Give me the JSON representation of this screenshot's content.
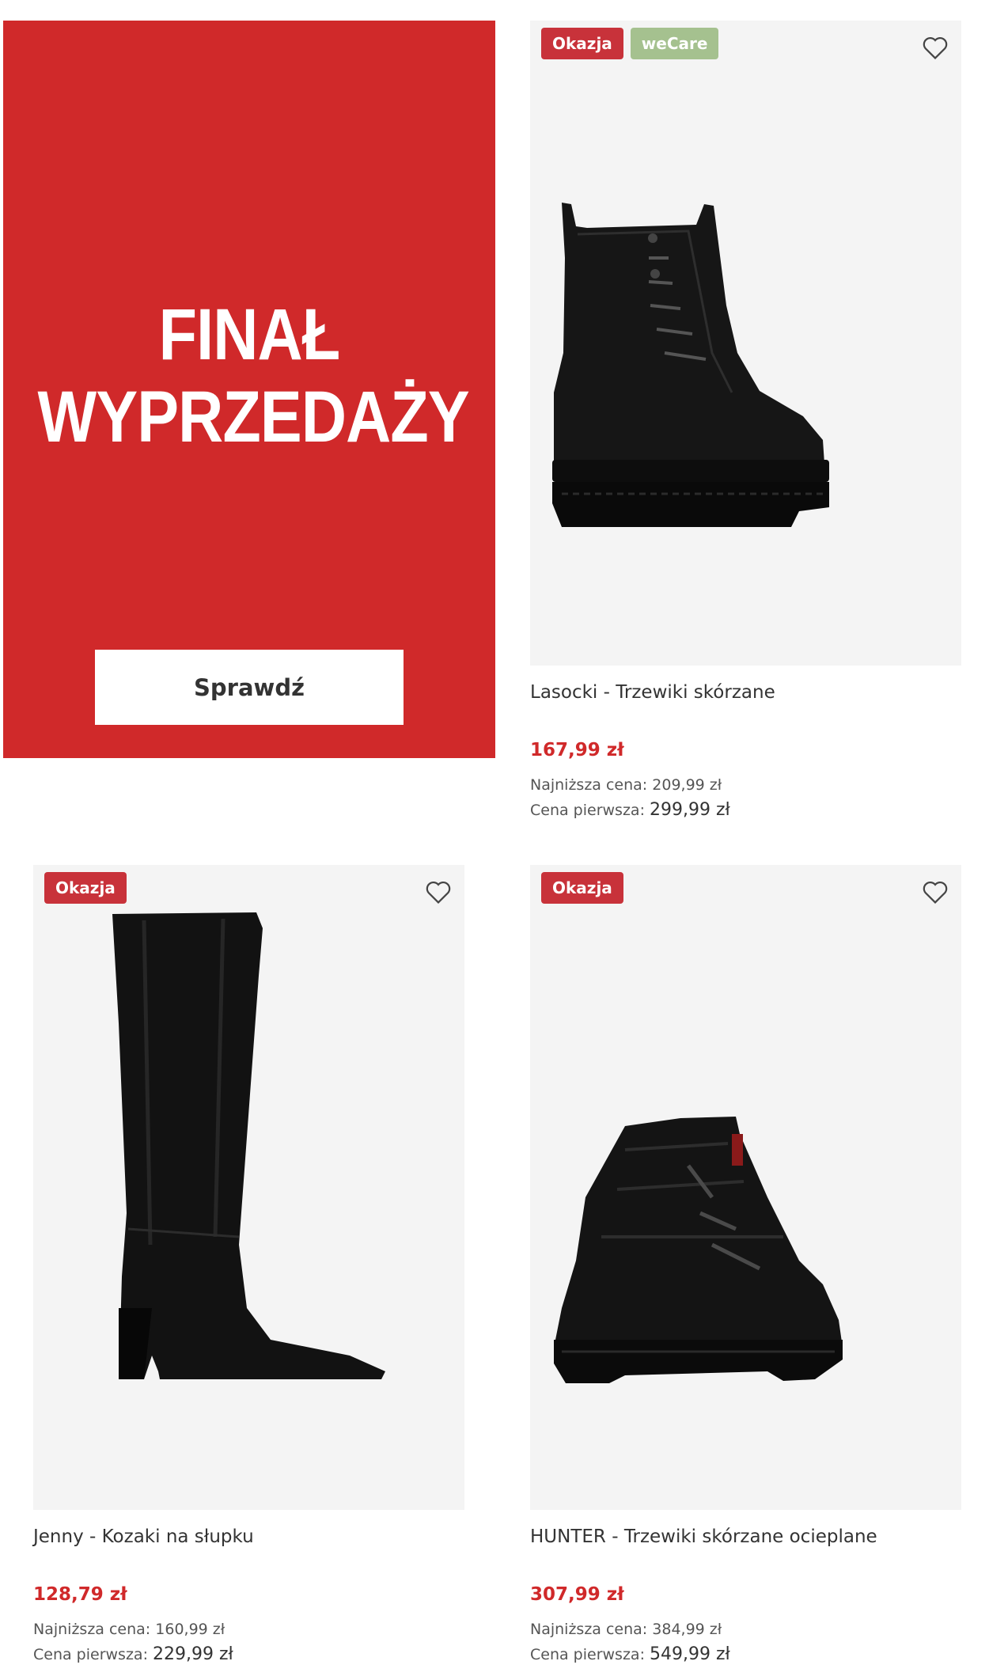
{
  "promo": {
    "title_line1": "FINAŁ",
    "title_line2": "WYPRZEDAŻY",
    "button_label": "Sprawdź"
  },
  "products": [
    {
      "name": "Lasocki - Trzewiki skórzane",
      "price": "167,99 zł",
      "lowest_label": "Najniższa cena:",
      "lowest_value": "209,99 zł",
      "first_label": "Cena pierwsza:",
      "first_value": "299,99 zł",
      "badges": [
        "Okazja",
        "weCare"
      ]
    },
    {
      "name": "Jenny - Kozaki na słupku",
      "price": "128,79 zł",
      "lowest_label": "Najniższa cena:",
      "lowest_value": "160,99 zł",
      "first_label": "Cena pierwsza:",
      "first_value": "229,99 zł",
      "badges": [
        "Okazja"
      ]
    },
    {
      "name": "HUNTER - Trzewiki skórzane ocieplane",
      "price": "307,99 zł",
      "lowest_label": "Najniższa cena:",
      "lowest_value": "384,99 zł",
      "first_label": "Cena pierwsza:",
      "first_value": "549,99 zł",
      "badges": [
        "Okazja"
      ]
    }
  ],
  "colors": {
    "promo_red": "#d0292a",
    "okazja_badge": "#c8323a",
    "wecare_badge": "#a5c18f",
    "price_red": "#d0292a"
  },
  "icons": {
    "favorite": "heart-outline-icon"
  }
}
